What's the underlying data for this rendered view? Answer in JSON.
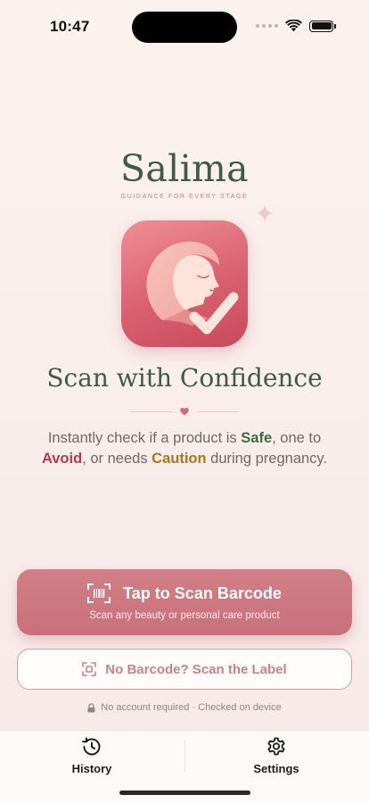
{
  "status_bar": {
    "time": "10:47"
  },
  "brand": {
    "name": "Salima",
    "tagline": "GUIDANCE FOR EVERY STAGE"
  },
  "headline": "Scan with Confidence",
  "description": {
    "part1": "Instantly check if a product is ",
    "safe": "Safe",
    "part2": ", one to ",
    "avoid": "Avoid",
    "part3": ", or needs ",
    "caution": "Caution",
    "part4": " during pregnancy."
  },
  "primary_button": {
    "title": "Tap to Scan Barcode",
    "subtitle": "Scan any beauty or personal care product"
  },
  "secondary_button": {
    "label": "No Barcode? Scan the Label"
  },
  "footnote": "No account required · Checked on device",
  "tabs": [
    {
      "label": "History",
      "icon": "history-icon"
    },
    {
      "label": "Settings",
      "icon": "gear-icon"
    }
  ],
  "colors": {
    "brand_green": "#3e5b48",
    "accent_rose": "#c8707b",
    "safe": "#3d6b45",
    "avoid": "#b53a4e",
    "caution": "#a9781b"
  }
}
